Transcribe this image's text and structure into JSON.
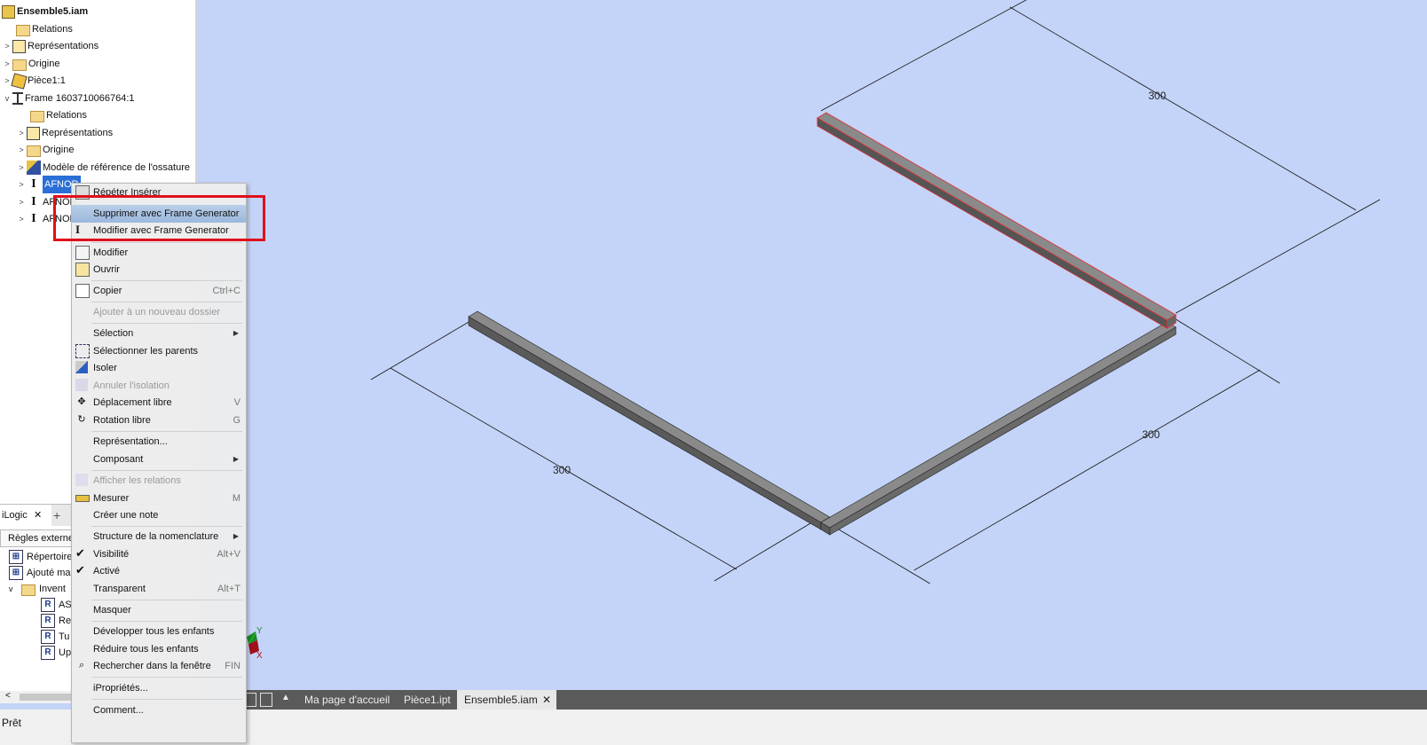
{
  "browser": {
    "root": "Ensemble5.iam",
    "items": [
      {
        "label": "Relations",
        "icon": "folder-icon"
      },
      {
        "label": "Représentations",
        "icon": "representations-icon"
      },
      {
        "label": "Origine",
        "icon": "folder-icon"
      },
      {
        "label": "Pièce1:1",
        "icon": "part-icon"
      },
      {
        "label": "Frame 1603710066764:1",
        "icon": "frame-icon"
      },
      {
        "label": "Relations",
        "icon": "folder-icon"
      },
      {
        "label": "Représentations",
        "icon": "representations-icon"
      },
      {
        "label": "Origine",
        "icon": "folder-icon"
      },
      {
        "label": "Modèle de référence de l'ossature",
        "icon": "skeleton-icon"
      },
      {
        "label": "AFNOR",
        "icon": "beam-icon"
      },
      {
        "label": "AFNOR",
        "icon": "beam-icon"
      },
      {
        "label": "AFNOR",
        "icon": "beam-icon"
      }
    ]
  },
  "ilogic": {
    "tab": "iLogic",
    "add": "+",
    "rules_tab": "Règles externe",
    "rows": [
      "Répertoire",
      "Ajouté ma",
      "Invent",
      "AS",
      "Re",
      "Tu",
      "Up"
    ]
  },
  "context_menu": {
    "items": [
      {
        "label": "Répéter Insérer",
        "shortcut": "",
        "icon": "repeat-insert-icon"
      },
      {
        "label": "Supprimer avec Frame Generator",
        "shortcut": "",
        "icon": ""
      },
      {
        "label": "Modifier avec Frame Generator",
        "shortcut": "",
        "icon": "frame-edit-icon"
      },
      {
        "label": "Modifier",
        "shortcut": "",
        "icon": "edit-icon"
      },
      {
        "label": "Ouvrir",
        "shortcut": "",
        "icon": "open-icon"
      },
      {
        "label": "Copier",
        "shortcut": "Ctrl+C",
        "icon": "copy-icon"
      },
      {
        "label": "Ajouter à un nouveau dossier",
        "shortcut": "",
        "icon": ""
      },
      {
        "label": "Sélection",
        "shortcut": "",
        "icon": ""
      },
      {
        "label": "Sélectionner les parents",
        "shortcut": "",
        "icon": "select-parents-icon"
      },
      {
        "label": "Isoler",
        "shortcut": "",
        "icon": "isolate-icon"
      },
      {
        "label": "Annuler l'isolation",
        "shortcut": "",
        "icon": "undo-isolate-icon"
      },
      {
        "label": "Déplacement libre",
        "shortcut": "V",
        "icon": "free-move-icon"
      },
      {
        "label": "Rotation libre",
        "shortcut": "G",
        "icon": "free-rotate-icon"
      },
      {
        "label": "Représentation...",
        "shortcut": "",
        "icon": ""
      },
      {
        "label": "Composant",
        "shortcut": "",
        "icon": ""
      },
      {
        "label": "Afficher les relations",
        "shortcut": "",
        "icon": "show-relations-icon"
      },
      {
        "label": "Mesurer",
        "shortcut": "M",
        "icon": "measure-icon"
      },
      {
        "label": "Créer une note",
        "shortcut": "",
        "icon": ""
      },
      {
        "label": "Structure de la nomenclature",
        "shortcut": "",
        "icon": ""
      },
      {
        "label": "Visibilité",
        "shortcut": "Alt+V",
        "icon": "check-icon"
      },
      {
        "label": "Activé",
        "shortcut": "",
        "icon": "check-icon"
      },
      {
        "label": "Transparent",
        "shortcut": "Alt+T",
        "icon": ""
      },
      {
        "label": "Masquer",
        "shortcut": "",
        "icon": ""
      },
      {
        "label": "Développer tous les enfants",
        "shortcut": "",
        "icon": ""
      },
      {
        "label": "Réduire tous les enfants",
        "shortcut": "",
        "icon": ""
      },
      {
        "label": "Rechercher dans la fenêtre",
        "shortcut": "FIN",
        "icon": "search-icon"
      },
      {
        "label": "iPropriétés...",
        "shortcut": "",
        "icon": ""
      },
      {
        "label": "Comment...",
        "shortcut": "",
        "icon": ""
      }
    ]
  },
  "dimensions": [
    "300",
    "300",
    "300"
  ],
  "triad": {
    "y": "Y",
    "x": "X"
  },
  "tabs": [
    {
      "label": "Ma page d'accueil"
    },
    {
      "label": "Pièce1.ipt"
    },
    {
      "label": "Ensemble5.iam"
    }
  ],
  "tab_close": "✕",
  "status": "Prêt",
  "colors": {
    "viewport": "#c4d4f8",
    "highlight_box": "#e0101a",
    "selection": "#2a6fd6"
  }
}
